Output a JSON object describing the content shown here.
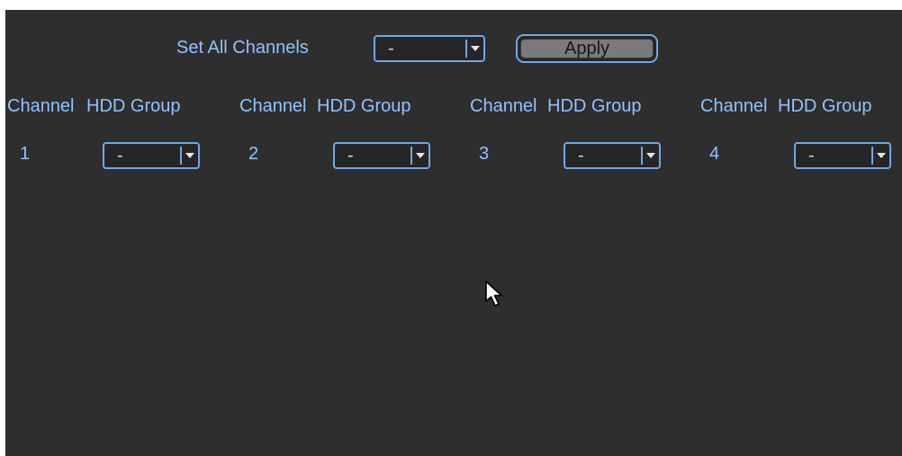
{
  "set_all": {
    "label": "Set All Channels",
    "selected": "-",
    "apply_label": "Apply"
  },
  "columns": {
    "channel_label": "Channel",
    "group_label": "HDD Group"
  },
  "channels": [
    {
      "number": "1",
      "group": "-"
    },
    {
      "number": "2",
      "group": "-"
    },
    {
      "number": "3",
      "group": "-"
    },
    {
      "number": "4",
      "group": "-"
    }
  ],
  "colors": {
    "background": "#2e2e2e",
    "text": "#8fc3ff",
    "border": "#6fa8e6"
  },
  "icons": {
    "dropdown": "chevron-down-icon",
    "cursor": "mouse-pointer-icon"
  }
}
